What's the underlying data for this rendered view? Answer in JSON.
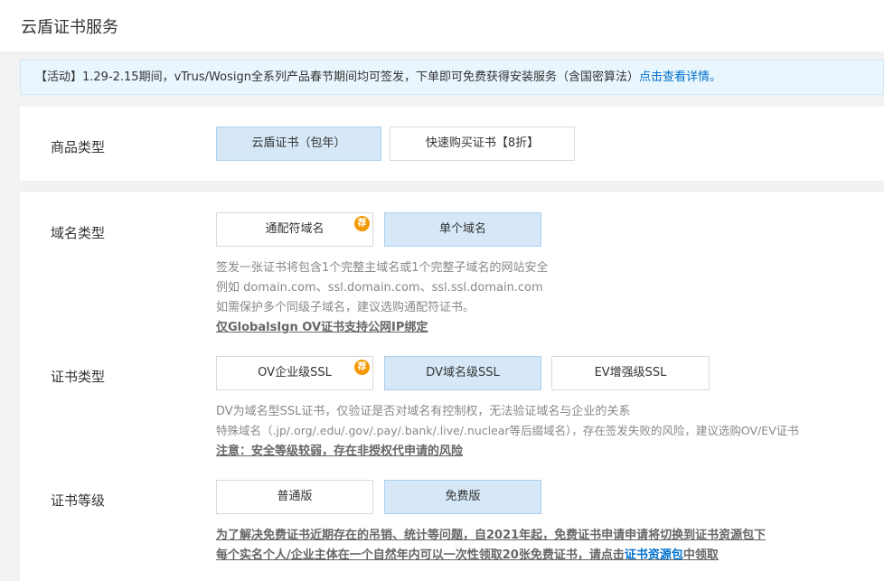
{
  "header": {
    "title": "云盾证书服务"
  },
  "notice": {
    "text": "【活动】1.29-2.15期间，vTrus/Wosign全系列产品春节期间均可签发，下单即可免费获得安装服务（含国密算法）",
    "link": "点击查看详情。"
  },
  "product_type": {
    "label": "商品类型",
    "options": [
      "云盾证书（包年）",
      "快速购买证书【8折】"
    ],
    "selected": "云盾证书（包年）"
  },
  "domain_type": {
    "label": "域名类型",
    "options": [
      "通配符域名",
      "单个域名"
    ],
    "selected": "单个域名",
    "badge": "荐",
    "desc": [
      "签发一张证书将包含1个完整主域名或1个完整子域名的网站安全",
      "例如 domain.com、ssl.domain.com、ssl.ssl.domain.com",
      "如需保护多个同级子域名，建议选购通配符证书。"
    ],
    "note": "仅GlobalsIgn OV证书支持公网IP绑定"
  },
  "cert_type": {
    "label": "证书类型",
    "options": [
      "OV企业级SSL",
      "DV域名级SSL",
      "EV增强级SSL"
    ],
    "selected": "DV域名级SSL",
    "badge": "荐",
    "desc": [
      "DV为域名型SSL证书，仅验证是否对域名有控制权，无法验证域名与企业的关系",
      "特殊域名（.jp/.org/.edu/.gov/.pay/.bank/.live/.nuclear等后缀域名），存在签发失败的风险，建议选购OV/EV证书"
    ],
    "note": "注意：安全等级较弱，存在非授权代申请的风险"
  },
  "cert_level": {
    "label": "证书等级",
    "options": [
      "普通版",
      "免费版"
    ],
    "selected": "免费版",
    "note1": "为了解决免费证书近期存在的吊销、统计等问题，自2021年起，免费证书申请申请将切换到证书资源包下",
    "note2_prefix": "每个实名个人/企业主体在一个自然年内可以一次性领取20张免费证书，请点击",
    "note2_link": "证书资源包",
    "note2_suffix": "中领取"
  }
}
